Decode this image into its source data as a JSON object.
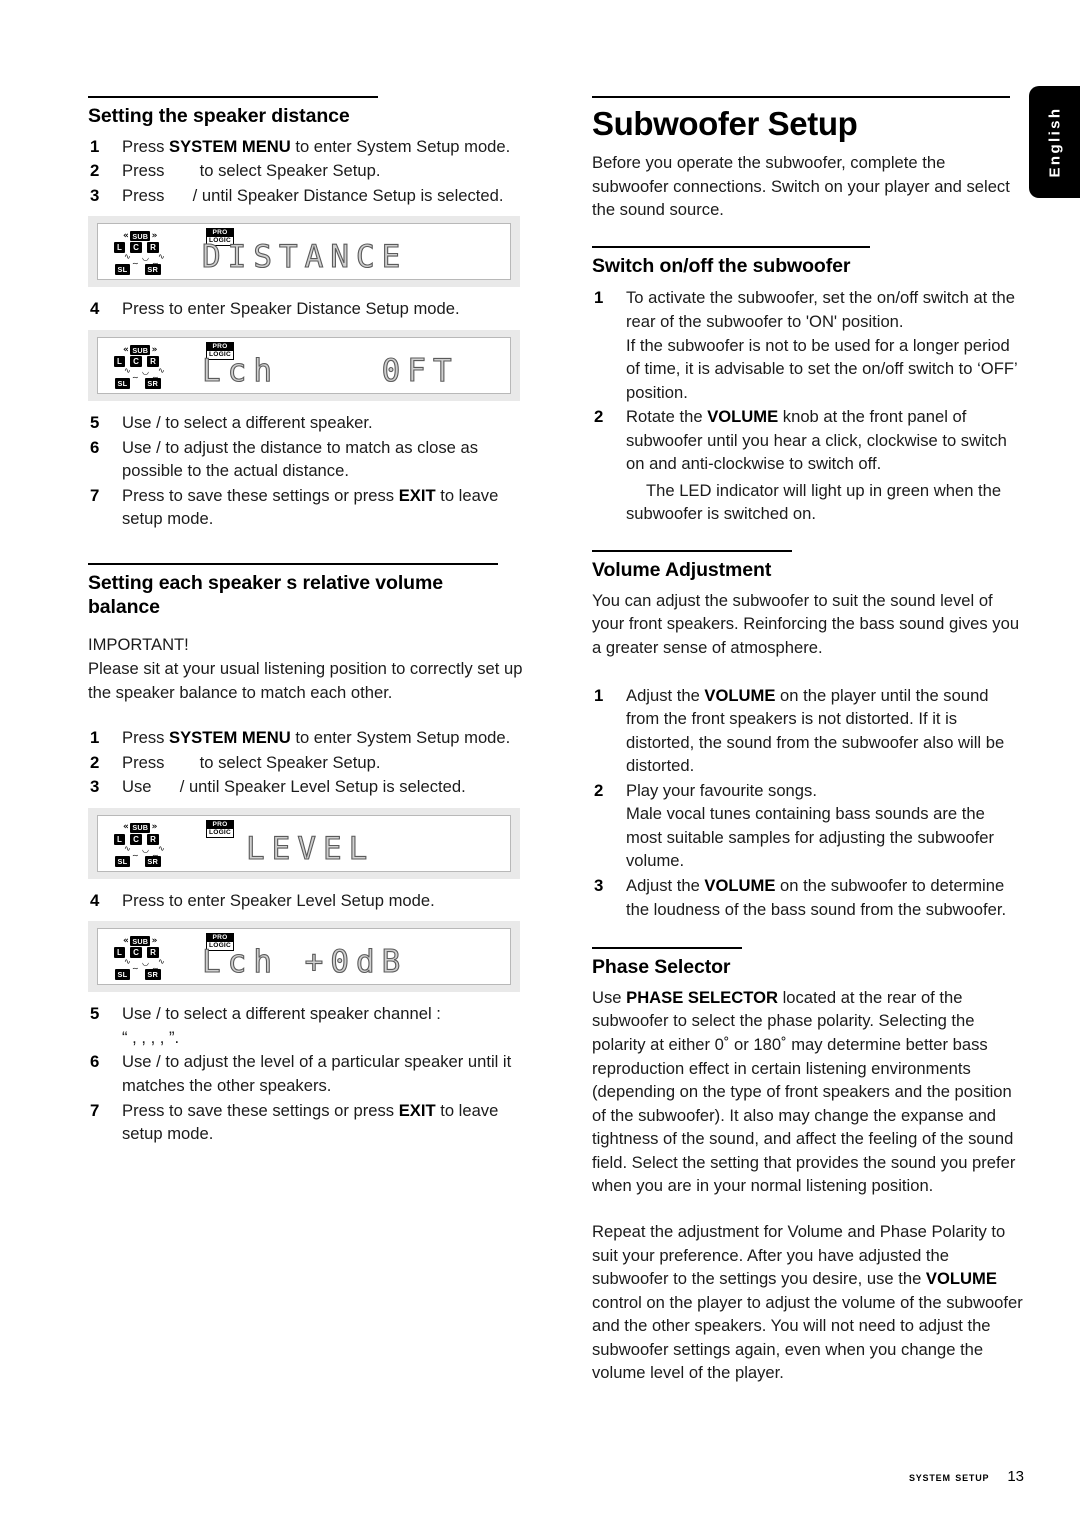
{
  "side_tab": {
    "label": "English"
  },
  "footer": {
    "label": "System Setup",
    "page_number": "13"
  },
  "left_column": {
    "section1": {
      "heading": "Setting the speaker distance",
      "steps": [
        {
          "num": "1",
          "pre": "Press ",
          "bold": "SYSTEM MENU",
          "post": " to enter System Setup mode."
        },
        {
          "num": "2",
          "pre": "Press ",
          "bold": "",
          "post": " to select Speaker Setup."
        },
        {
          "num": "3",
          "pre": "Press ",
          "bold": "",
          "post": " /    until Speaker Distance Setup is selected."
        }
      ],
      "display1": {
        "text": "DISTANCE",
        "prologic_top": "PRO",
        "prologic_bottom": "LOGIC"
      },
      "step4": {
        "num": "4",
        "text": "Press       to enter Speaker Distance Setup mode."
      },
      "display2": {
        "text": "Lch    0FT",
        "prologic_top": "PRO",
        "prologic_bottom": "LOGIC"
      },
      "steps_after": [
        {
          "num": "5",
          "text": "Use  /   to select a different speaker."
        },
        {
          "num": "6",
          "text": "Use     /     to adjust the distance to match as close as possible to the actual distance."
        },
        {
          "num": "7",
          "pre": "Press       to save these settings or press ",
          "bold": "EXIT",
          "post": " to leave setup mode."
        }
      ]
    },
    "section2": {
      "heading": "Setting each speaker s relative volume balance",
      "important_label": "IMPORTANT!",
      "important_text": "Please sit at your usual listening position to correctly set up the speaker balance to match each other.",
      "steps": [
        {
          "num": "1",
          "pre": "Press ",
          "bold": "SYSTEM MENU",
          "post": " to enter System Setup mode."
        },
        {
          "num": "2",
          "pre": "Press ",
          "bold": "",
          "post": " to select Speaker Setup."
        },
        {
          "num": "3",
          "pre": "Use ",
          "bold": "",
          "post": " /   until Speaker Level Setup is selected."
        }
      ],
      "display3": {
        "text": "LEVEL",
        "prologic_top": "PRO",
        "prologic_bottom": "LOGIC"
      },
      "step4": {
        "num": "4",
        "text": "Press       to enter Speaker Level Setup mode."
      },
      "display4": {
        "text": "Lch +0dB",
        "prologic_top": "PRO",
        "prologic_bottom": "LOGIC"
      },
      "steps_after": [
        {
          "num": "5",
          "text": "Use  /   to select a different speaker channel :",
          "sub": "“      ,       ,      ,         ,        ”."
        },
        {
          "num": "6",
          "text": "Use    /      to adjust the level of a particular speaker until it matches the other speakers."
        },
        {
          "num": "7",
          "pre": "Press       to save these settings or press ",
          "bold": "EXIT",
          "post": " to leave setup mode."
        }
      ]
    }
  },
  "right_column": {
    "title": "Subwoofer Setup",
    "intro": "Before you operate the subwoofer, complete the subwoofer connections. Switch on your player and select the sound source.",
    "section_switch": {
      "heading": "Switch on/off the subwoofer",
      "step1": {
        "num": "1",
        "line1": "To activate the subwoofer, set the on/off switch at the rear of the subwoofer to 'ON' position.",
        "line2": "If the subwoofer is not to be used for a longer period of time, it is advisable to set the on/off switch to ‘OFF’ position."
      },
      "step2": {
        "num": "2",
        "pre": "Rotate the ",
        "bold": "VOLUME",
        "post": " knob at the front panel of subwoofer until you hear a click, clockwise to switch on and anti-clockwise to switch off.",
        "note": "The LED indicator will light up in green when the subwoofer is switched on."
      }
    },
    "section_volume": {
      "heading": "Volume Adjustment",
      "intro": "You can adjust the subwoofer to suit the sound level of your front speakers.  Reinforcing the bass sound gives you a greater sense of atmosphere.",
      "steps": [
        {
          "num": "1",
          "pre": "Adjust the ",
          "bold": "VOLUME",
          "post": " on the player until the sound from the front speakers is not distorted. If it is distorted, the sound from the subwoofer also will be distorted."
        },
        {
          "num": "2",
          "pre": "Play your favourite songs.",
          "bold": "",
          "post": "",
          "note": "Male vocal tunes containing bass sounds are the most suitable samples for adjusting the subwoofer volume."
        },
        {
          "num": "3",
          "pre": "Adjust the ",
          "bold": "VOLUME",
          "post": " on the subwoofer to determine the loudness of the bass sound from the subwoofer."
        }
      ]
    },
    "section_phase": {
      "heading": "Phase Selector",
      "pre": "Use ",
      "bold": "PHASE SELECTOR",
      "post": " located at the rear of the subwoofer to select the phase polarity. Selecting the polarity at either 0˚ or 180˚ may determine better bass reproduction effect in certain listening environments (depending on the type of front speakers and the position of the subwoofer). It also may change the expanse and tightness of the sound, and affect the feeling of the sound field.  Select the setting that provides the sound you prefer when you are in your normal listening position.",
      "closing_pre": "Repeat the adjustment for Volume and Phase Polarity to suit your preference.  After you have adjusted the subwoofer to the settings you desire, use the ",
      "closing_bold": "VOLUME",
      "closing_post": " control on the player to adjust the volume of the subwoofer and the other speakers. You will not need to adjust the subwoofer settings again, even when you change the volume level of the player."
    }
  },
  "lcd_labels": {
    "sub": "SUB",
    "l": "L",
    "c": "C",
    "r": "R",
    "sl": "SL",
    "sr": "SR",
    "paren_left": "«",
    "paren_right": "»"
  }
}
